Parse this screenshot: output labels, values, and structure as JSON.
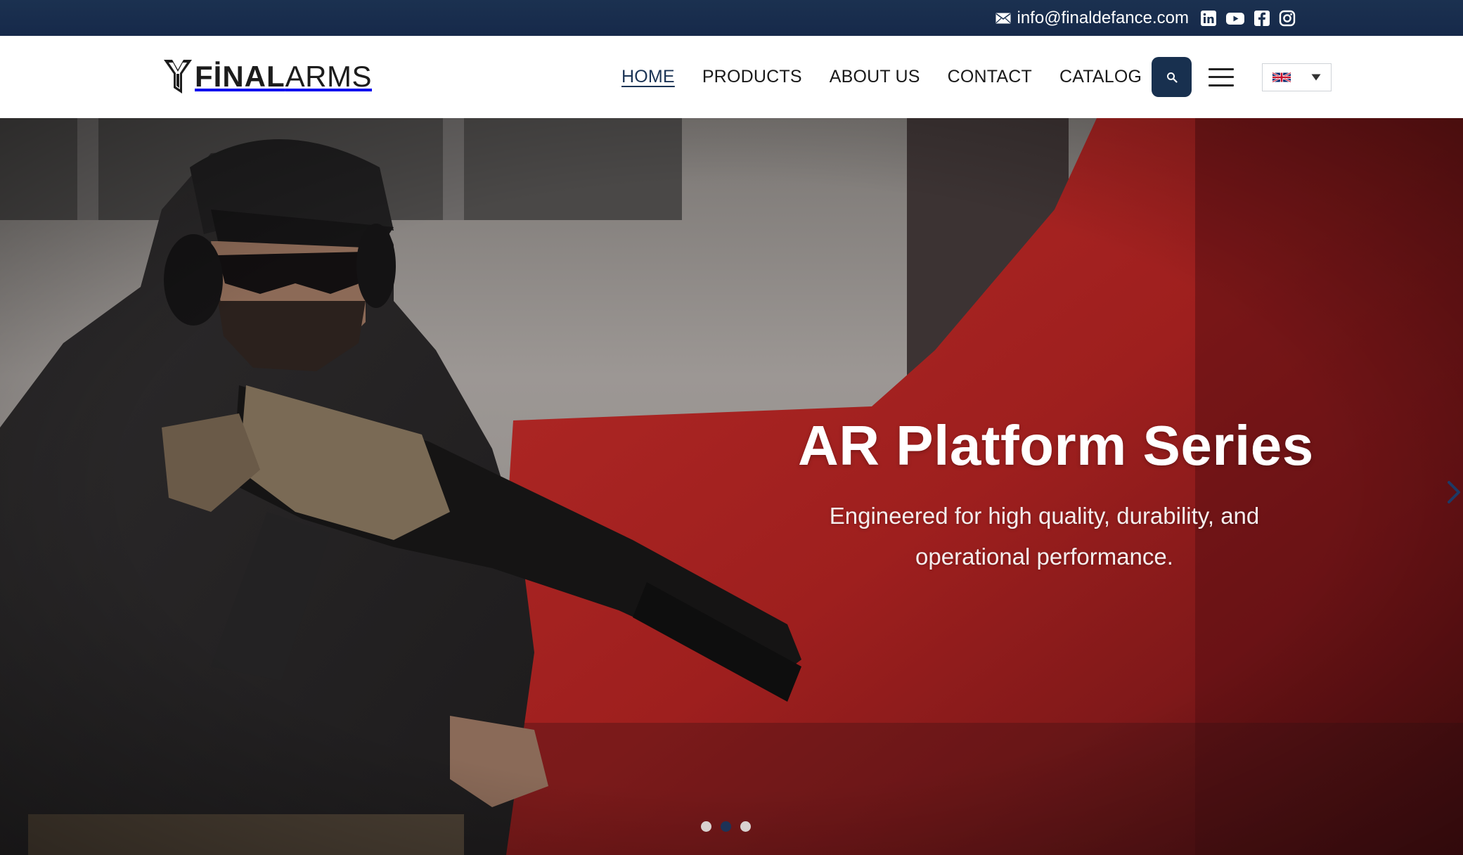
{
  "topbar": {
    "email": "info@finaldefance.com",
    "icons": [
      "envelope-icon",
      "linkedin-icon",
      "youtube-icon",
      "facebook-icon",
      "instagram-icon"
    ]
  },
  "header": {
    "logo": {
      "bold": "FİNAL",
      "light": "ARMS"
    },
    "nav": [
      {
        "label": "HOME",
        "active": true
      },
      {
        "label": "PRODUCTS",
        "active": false
      },
      {
        "label": "ABOUT US",
        "active": false
      },
      {
        "label": "CONTACT",
        "active": false
      },
      {
        "label": "CATALOG",
        "active": false
      }
    ],
    "icons": {
      "search": "search-icon",
      "menu": "hamburger-menu-icon",
      "language": "uk-flag-icon",
      "dropdown": "caret-down-icon"
    }
  },
  "hero": {
    "title": "AR Platform Series",
    "subtitle": "Engineered for high quality, durability, and operational performance.",
    "slides": 3,
    "active_slide": 2
  },
  "colors": {
    "topbar": "#1b3150",
    "nav_active": "#1b3455",
    "search_button": "#18304f",
    "hero_red": "#a61f1f",
    "dot_active": "#1d3357"
  }
}
